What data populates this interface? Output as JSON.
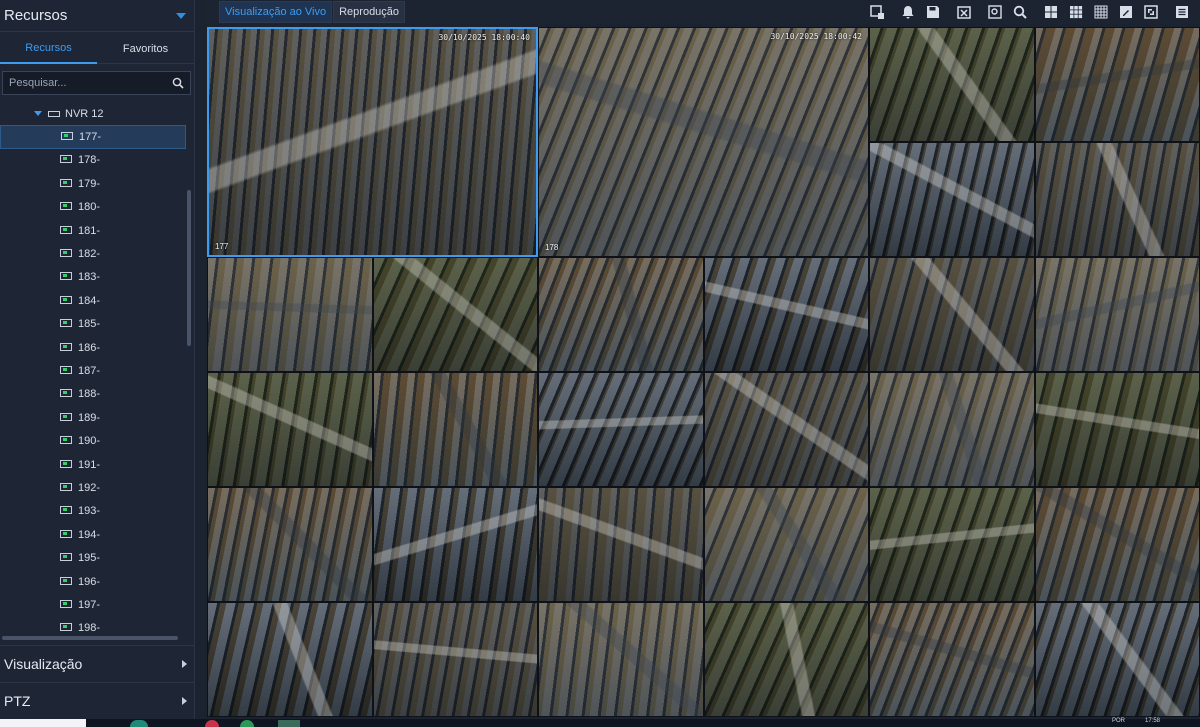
{
  "sidebar": {
    "title": "Recursos",
    "tabs": [
      "Recursos",
      "Favoritos"
    ],
    "search_placeholder": "Pesquisar...",
    "nvr_label": "NVR 12",
    "cameras": [
      "177-",
      "178-",
      "179-",
      "180-",
      "181-",
      "182-",
      "183-",
      "184-",
      "185-",
      "186-",
      "187-",
      "188-",
      "189-",
      "190-",
      "191-",
      "192-",
      "193-",
      "194-",
      "195-",
      "196-",
      "197-",
      "198-"
    ],
    "sections": [
      "Visualização",
      "PTZ"
    ]
  },
  "topbar": {
    "tabs": [
      "Visualização ao Vivo",
      "Reprodução"
    ],
    "tools": [
      "add-window-icon",
      "alarm-bell-icon",
      "save-icon",
      "delete-icon",
      "search-view-icon",
      "zoom-icon",
      "layout-2x2-icon",
      "layout-3x3-icon",
      "layout-4x4-icon",
      "edit-icon",
      "fullscreen-icon",
      "menu-icon"
    ]
  },
  "grid": {
    "big_tiles": [
      {
        "timestamp": "30/10/2025 18:00:40",
        "channel": "177"
      },
      {
        "timestamp": "30/10/2025 18:00:42",
        "channel": "178"
      }
    ]
  },
  "taskbar": {
    "tray_left": "POR",
    "tray_time": "17:58"
  },
  "colors": {
    "accent": "#3d9cf0",
    "panel": "#1e2636",
    "online": "#33d16a"
  }
}
